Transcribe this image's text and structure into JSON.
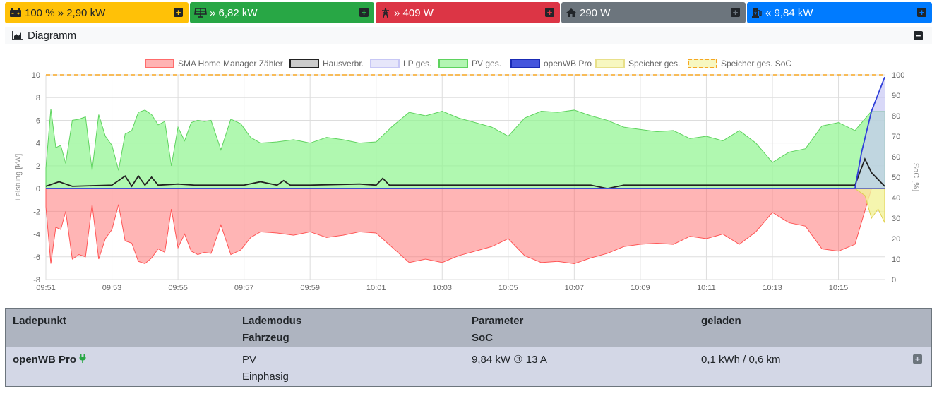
{
  "tiles": {
    "battery": {
      "text": "100 % » 2,90 kW",
      "icon": "car-battery-icon"
    },
    "pv": {
      "text": "» 6,82 kW",
      "icon": "solar-panel-icon"
    },
    "grid": {
      "text": "» 409 W",
      "icon": "power-pylon-icon"
    },
    "house": {
      "text": "290 W",
      "icon": "home-icon"
    },
    "charge": {
      "text": "« 9,84 kW",
      "icon": "charging-station-icon"
    }
  },
  "diagram": {
    "title": "Diagramm"
  },
  "chart_data": {
    "type": "area",
    "legend": [
      "SMA Home Manager Zähler",
      "Hausverbr.",
      "LP ges.",
      "PV ges.",
      "openWB Pro",
      "Speicher ges.",
      "Speicher ges. SoC"
    ],
    "legend_placement": "top-center",
    "ylabel": "Leistung [kW]",
    "y2label": "SoC [%]",
    "ylim": [
      -8,
      10
    ],
    "y2lim": [
      0,
      100
    ],
    "yticks": [
      "-8",
      "-6",
      "-4",
      "-2",
      "0",
      "2",
      "4",
      "6",
      "8",
      "10"
    ],
    "y2ticks": [
      "0",
      "10",
      "20",
      "30",
      "40",
      "50",
      "60",
      "70",
      "80",
      "90",
      "100"
    ],
    "xticks": [
      "09:51",
      "09:53",
      "09:55",
      "09:57",
      "09:59",
      "10:01",
      "10:03",
      "10:05",
      "10:07",
      "10:09",
      "10:11",
      "10:13",
      "10:15"
    ],
    "xlim": [
      0,
      25.4
    ],
    "grid": true,
    "colors": {
      "grid": "#ff6b6b",
      "house": "#222222",
      "lp": "#c7c7f5",
      "pv": "#8ef58e",
      "openwb": "#2f3fd9",
      "battery": "#f2f29a",
      "soc": "#f5a623"
    },
    "series": [
      {
        "name": "PV ges.",
        "x": [
          0,
          0.15,
          0.3,
          0.45,
          0.6,
          0.8,
          1.0,
          1.2,
          1.4,
          1.6,
          1.8,
          2.0,
          2.2,
          2.4,
          2.6,
          2.8,
          3.0,
          3.2,
          3.4,
          3.6,
          3.8,
          4.0,
          4.2,
          4.4,
          4.6,
          4.8,
          5.0,
          5.3,
          5.6,
          5.9,
          6.2,
          6.5,
          7.0,
          7.5,
          8.0,
          8.5,
          9.0,
          9.5,
          10.0,
          10.5,
          11.0,
          11.5,
          12.0,
          12.5,
          13.0,
          13.5,
          14.0,
          14.5,
          15.0,
          15.5,
          16.0,
          16.5,
          17.0,
          17.5,
          18.0,
          18.5,
          19.0,
          19.5,
          20.0,
          20.5,
          21.0,
          21.5,
          22.0,
          22.5,
          23.0,
          23.5,
          24.0,
          24.5,
          25.0,
          25.4
        ],
        "y": [
          1.8,
          7.0,
          3.6,
          3.8,
          2.2,
          6.0,
          6.1,
          6.3,
          1.6,
          6.5,
          4.6,
          3.8,
          1.6,
          4.8,
          5.1,
          6.7,
          6.9,
          6.5,
          5.6,
          5.9,
          2.0,
          5.4,
          4.2,
          5.8,
          6.0,
          5.9,
          6.0,
          3.4,
          6.1,
          5.7,
          4.5,
          4.0,
          4.1,
          4.3,
          4.0,
          4.5,
          4.3,
          4.0,
          4.1,
          5.5,
          6.7,
          6.4,
          6.8,
          6.2,
          5.8,
          5.4,
          4.6,
          6.2,
          6.8,
          6.7,
          6.9,
          6.4,
          6.0,
          5.4,
          5.2,
          5.0,
          5.1,
          4.4,
          4.6,
          4.2,
          5.1,
          4.0,
          2.3,
          3.2,
          3.5,
          5.5,
          5.8,
          5.1,
          6.8,
          6.8
        ]
      },
      {
        "name": "SMA Home Manager Zähler",
        "x": [
          0,
          0.15,
          0.3,
          0.45,
          0.6,
          0.8,
          1.0,
          1.2,
          1.4,
          1.6,
          1.8,
          2.0,
          2.2,
          2.4,
          2.6,
          2.8,
          3.0,
          3.2,
          3.4,
          3.6,
          3.8,
          4.0,
          4.2,
          4.4,
          4.6,
          4.8,
          5.0,
          5.3,
          5.6,
          5.9,
          6.2,
          6.5,
          7.0,
          7.5,
          8.0,
          8.5,
          9.0,
          9.5,
          10.0,
          10.5,
          11.0,
          11.5,
          12.0,
          12.5,
          13.0,
          13.5,
          14.0,
          14.5,
          15.0,
          15.5,
          16.0,
          16.5,
          17.0,
          17.5,
          18.0,
          18.5,
          19.0,
          19.5,
          20.0,
          20.5,
          21.0,
          21.5,
          22.0,
          22.5,
          23.0,
          23.5,
          24.0,
          24.5,
          25.0,
          25.4
        ],
        "y": [
          -1.6,
          -6.6,
          -3.4,
          -3.6,
          -2.0,
          -6.2,
          -5.8,
          -6.0,
          -1.4,
          -6.2,
          -4.4,
          -3.6,
          -1.4,
          -4.6,
          -4.8,
          -6.4,
          -6.6,
          -6.1,
          -5.3,
          -5.6,
          -1.8,
          -5.2,
          -4.0,
          -5.5,
          -5.8,
          -5.6,
          -5.7,
          -3.2,
          -5.8,
          -5.4,
          -4.3,
          -3.8,
          -3.9,
          -4.1,
          -3.8,
          -4.3,
          -4.1,
          -3.8,
          -3.9,
          -5.2,
          -6.5,
          -6.2,
          -6.5,
          -5.9,
          -5.5,
          -5.1,
          -4.4,
          -5.9,
          -6.5,
          -6.4,
          -6.6,
          -6.1,
          -5.7,
          -5.1,
          -4.9,
          -4.8,
          -4.9,
          -4.2,
          -4.4,
          -4.0,
          -4.9,
          -3.8,
          -2.1,
          -3.0,
          -3.3,
          -5.3,
          -5.5,
          -4.9,
          0.0,
          0.0
        ]
      },
      {
        "name": "Hausverbr.",
        "x": [
          0,
          0.4,
          0.6,
          0.8,
          2.0,
          2.4,
          2.6,
          2.8,
          3.0,
          3.2,
          3.4,
          4.0,
          4.5,
          6.0,
          6.5,
          7.0,
          7.2,
          7.4,
          8.0,
          9.5,
          10.0,
          10.2,
          10.4,
          11.0,
          14.0,
          15.0,
          16.5,
          17.0,
          17.5,
          20.0,
          22.0,
          24.5,
          24.8,
          25.0,
          25.4
        ],
        "y": [
          0.2,
          0.6,
          0.4,
          0.2,
          0.3,
          1.1,
          0.2,
          1.1,
          0.3,
          1.0,
          0.3,
          0.4,
          0.3,
          0.3,
          0.6,
          0.3,
          0.7,
          0.3,
          0.3,
          0.4,
          0.3,
          0.9,
          0.3,
          0.3,
          0.3,
          0.3,
          0.3,
          0.0,
          0.3,
          0.3,
          0.3,
          0.3,
          2.6,
          1.4,
          0.2
        ]
      },
      {
        "name": "openWB Pro",
        "x": [
          0,
          24.5,
          24.7,
          25.0,
          25.4
        ],
        "y": [
          0,
          0,
          3.2,
          6.8,
          9.8
        ]
      },
      {
        "name": "LP ges.",
        "x": [
          0,
          24.5,
          24.7,
          25.0,
          25.4
        ],
        "y": [
          0,
          0,
          3.2,
          6.8,
          9.8
        ]
      },
      {
        "name": "Speicher ges.",
        "x": [
          0,
          24.5,
          24.8,
          25.0,
          25.2,
          25.4
        ],
        "y": [
          0,
          0,
          -0.6,
          -2.6,
          -1.8,
          -3.0
        ]
      },
      {
        "name": "Speicher ges. SoC",
        "x": [
          0,
          25.4
        ],
        "y": [
          100,
          100
        ]
      }
    ]
  },
  "table": {
    "headers": {
      "ladepunkt": "Ladepunkt",
      "lademodus": "Lademodus",
      "fahrzeug": "Fahrzeug",
      "parameter": "Parameter",
      "soc": "SoC",
      "geladen": "geladen"
    },
    "rows": [
      {
        "name": "openWB Pro",
        "mode": "PV",
        "phase": "Einphasig",
        "param": "9,84 kW ③ 13 A",
        "charged": "0,1 kWh / 0,6 km"
      }
    ]
  }
}
